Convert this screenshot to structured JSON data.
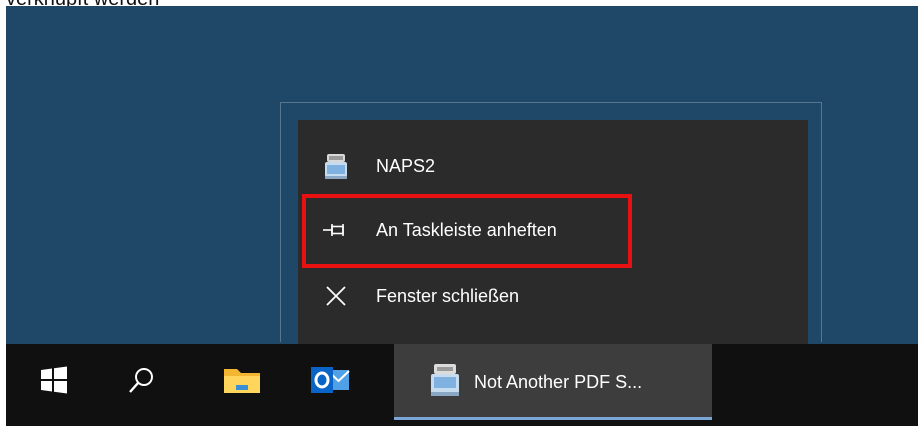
{
  "caption": {
    "cut_text": "verknüpft werden"
  },
  "jumplist": {
    "items": [
      {
        "label": "NAPS2",
        "icon": "naps2-scanner-icon"
      },
      {
        "label": "An Taskleiste anheften",
        "icon": "pin-icon"
      },
      {
        "label": "Fenster schließen",
        "icon": "close-icon"
      }
    ]
  },
  "taskbar": {
    "start_icon": "windows-start-icon",
    "search_icon": "search-icon",
    "explorer_icon": "file-explorer-icon",
    "outlook_icon": "outlook-icon",
    "active_app": {
      "label": "Not Another PDF S...",
      "icon": "naps2-scanner-icon"
    }
  },
  "colors": {
    "desktop": "#1f4868",
    "jumplist_bg": "#2b2b2b",
    "taskbar_bg": "#101010",
    "active_task_bg": "#3d3d3d",
    "highlight": "#e81010",
    "indicator": "#7aa7d6"
  }
}
